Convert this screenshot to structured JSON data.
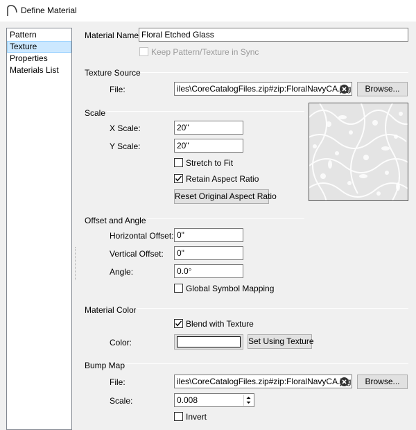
{
  "window": {
    "title": "Define Material",
    "icon": "arch-icon"
  },
  "sidebar": {
    "items": [
      {
        "label": "Pattern",
        "selected": false
      },
      {
        "label": "Texture",
        "selected": true
      },
      {
        "label": "Properties",
        "selected": false
      },
      {
        "label": "Materials List",
        "selected": false
      }
    ]
  },
  "material": {
    "name_label": "Material Name:",
    "name_value": "Floral Etched Glass",
    "keep_sync_label": "Keep Pattern/Texture in Sync",
    "keep_sync_checked": false,
    "keep_sync_enabled": false
  },
  "texture_source": {
    "heading": "Texture Source",
    "file_label": "File:",
    "file_value": "iles\\CoreCatalogFiles.zip#zip:FloralNavyCA.jpg",
    "browse_label": "Browse..."
  },
  "scale": {
    "heading": "Scale",
    "x_label": "X Scale:",
    "x_value": "20\"",
    "y_label": "Y Scale:",
    "y_value": "20\"",
    "stretch_label": "Stretch to Fit",
    "stretch_checked": false,
    "retain_label": "Retain Aspect Ratio",
    "retain_checked": true,
    "reset_label": "Reset Original Aspect Ratio"
  },
  "offset": {
    "heading": "Offset and Angle",
    "h_label": "Horizontal Offset:",
    "h_value": "0\"",
    "v_label": "Vertical Offset:",
    "v_value": "0\"",
    "angle_label": "Angle:",
    "angle_value": "0.0°",
    "global_label": "Global Symbol Mapping",
    "global_checked": false
  },
  "material_color": {
    "heading": "Material Color",
    "blend_label": "Blend with Texture",
    "blend_checked": true,
    "color_label": "Color:",
    "color_value": "#ffffff",
    "set_using_label": "Set Using Texture"
  },
  "bump_map": {
    "heading": "Bump Map",
    "file_label": "File:",
    "file_value": "iles\\CoreCatalogFiles.zip#zip:FloralNavyCA.jpg",
    "browse_label": "Browse...",
    "scale_label": "Scale:",
    "scale_value": "0.008",
    "invert_label": "Invert",
    "invert_checked": false
  }
}
